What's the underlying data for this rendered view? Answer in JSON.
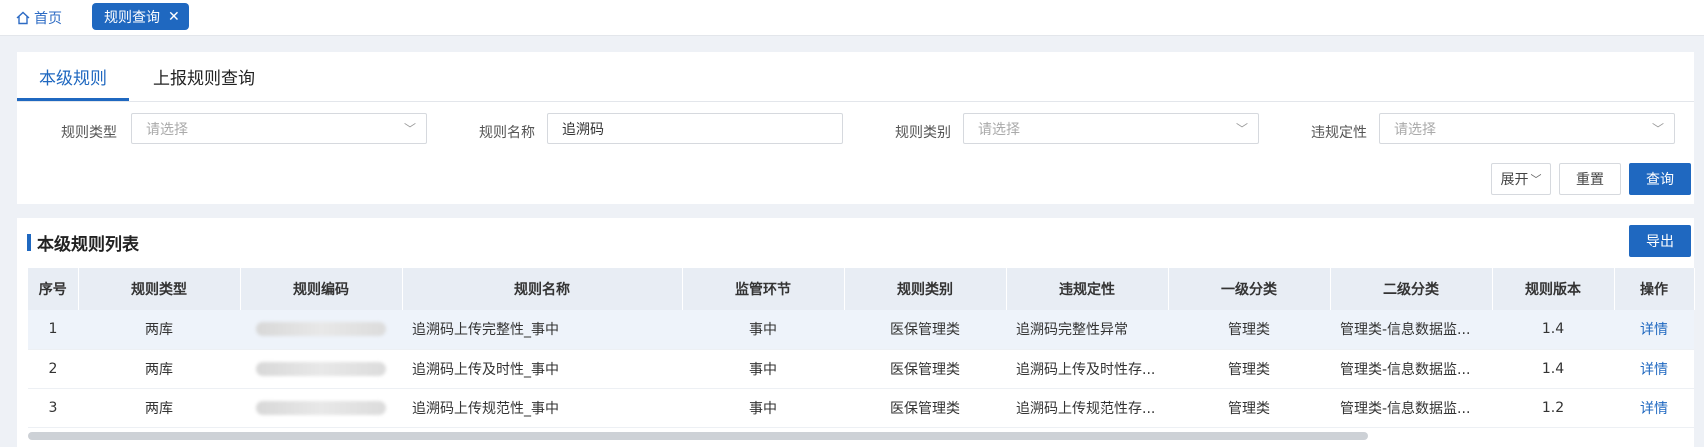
{
  "tabs": {
    "home_label": "首页",
    "active_label": "规则查询",
    "close_glyph": "✕"
  },
  "subtabs": [
    "本级规则",
    "上报规则查询"
  ],
  "filters": [
    {
      "label": "规则类型",
      "value": "",
      "placeholder": "请选择",
      "type": "select"
    },
    {
      "label": "规则名称",
      "value": "追溯码",
      "placeholder": "",
      "type": "input"
    },
    {
      "label": "规则类别",
      "value": "",
      "placeholder": "请选择",
      "type": "select"
    },
    {
      "label": "违规定性",
      "value": "",
      "placeholder": "请选择",
      "type": "select"
    }
  ],
  "buttons": {
    "expand": "展开",
    "reset": "重置",
    "search": "查询",
    "export": "导出"
  },
  "list": {
    "title": "本级规则列表",
    "columns": [
      "序号",
      "规则类型",
      "规则编码",
      "规则名称",
      "监管环节",
      "规则类别",
      "违规定性",
      "一级分类",
      "二级分类",
      "规则版本",
      "操作"
    ],
    "rows": [
      {
        "no": "1",
        "type": "两库",
        "name": "追溯码上传完整性_事中",
        "stage": "事中",
        "category": "医保管理类",
        "nature": "追溯码完整性异常",
        "level1": "管理类",
        "level2": "管理类-信息数据监...",
        "version": "1.4",
        "action": "详情"
      },
      {
        "no": "2",
        "type": "两库",
        "name": "追溯码上传及时性_事中",
        "stage": "事中",
        "category": "医保管理类",
        "nature": "追溯码上传及时性存...",
        "level1": "管理类",
        "level2": "管理类-信息数据监...",
        "version": "1.4",
        "action": "详情"
      },
      {
        "no": "3",
        "type": "两库",
        "name": "追溯码上传规范性_事中",
        "stage": "事中",
        "category": "医保管理类",
        "nature": "追溯码上传规范性存...",
        "level1": "管理类",
        "level2": "管理类-信息数据监...",
        "version": "1.2",
        "action": "详情"
      }
    ]
  },
  "colors": {
    "accent": "#1f68c0",
    "header_bg": "#e8edf4"
  }
}
